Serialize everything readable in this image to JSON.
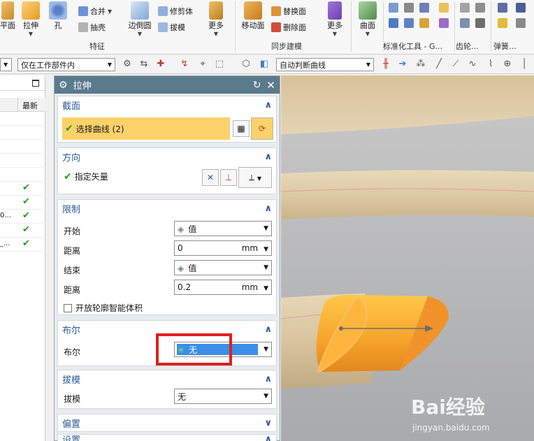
{
  "ribbon": {
    "plane_label": "平面",
    "extrude_label": "拉伸",
    "hole_label": "孔",
    "unite_label": "合并",
    "shell_label": "抽壳",
    "edge_blend_label": "边倒圆",
    "trim_body_label": "修剪体",
    "draft_label": "拔模",
    "more_label_1": "更多",
    "group_feature": "特征",
    "move_face_label": "移动面",
    "replace_face_label": "替换面",
    "delete_face_label": "删除面",
    "more_label_2": "更多",
    "group_sync": "同步建模",
    "surface_label": "曲面",
    "group_std": "标准化工具 - G...",
    "group_gear": "齿轮...",
    "group_spring": "弹簧..."
  },
  "toolbar2": {
    "scope_value": "仅在工作部件内",
    "curve_rule_value": "自动判断曲线"
  },
  "navigator": {
    "col_latest": "最新",
    "row_text_1": "0...",
    "row_text_2": "_..."
  },
  "dialog": {
    "title": "拉伸",
    "section_section": "截面",
    "select_curve": "选择曲线 (2)",
    "section_direction": "方向",
    "specify_vector": "指定矢量",
    "section_limits": "限制",
    "start_label": "开始",
    "start_mode": "值",
    "distance_label_1": "距离",
    "distance_value_1": "0",
    "unit_1": "mm",
    "end_label": "结束",
    "end_mode": "值",
    "distance_label_2": "距离",
    "distance_value_2": "0.2",
    "unit_2": "mm",
    "open_profile": "开放轮廓智能体积",
    "section_boolean": "布尔",
    "boolean_label": "布尔",
    "boolean_value": "无",
    "section_draft": "拔模",
    "draft_label": "拔模",
    "draft_value": "无",
    "section_offset": "偏置",
    "section_settings": "设置"
  },
  "watermark": {
    "brand": "Bai经验",
    "url": "jingyan.baidu.com"
  },
  "colors": {
    "title_bar": "#5a7b8c",
    "section_head": "#2c5a9a",
    "selected_row": "#fbd16a",
    "boolean_highlight": "#3b8fe6",
    "annotation_box": "#e0201c",
    "solid_orange": "#f6a32a",
    "pipe_tan": "#dcc8a4",
    "check_green": "#1aa31a"
  }
}
